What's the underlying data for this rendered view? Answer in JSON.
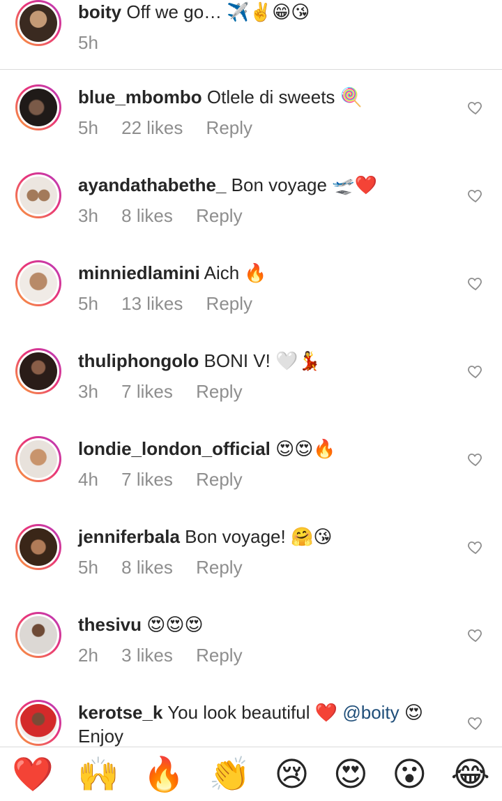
{
  "caption": {
    "username": "boity",
    "text": "Off we go… ✈️✌️😁😘",
    "time": "5h"
  },
  "comments": [
    {
      "username": "blue_mbombo",
      "text": "Otlele di sweets 🍭",
      "time": "5h",
      "likes": "22 likes",
      "reply": "Reply"
    },
    {
      "username": "ayandathabethe_",
      "text": "Bon voyage 🛫❤️",
      "time": "3h",
      "likes": "8 likes",
      "reply": "Reply"
    },
    {
      "username": "minniedlamini",
      "text": "Aich 🔥",
      "time": "5h",
      "likes": "13 likes",
      "reply": "Reply"
    },
    {
      "username": "thuliphongolo",
      "text": "BONI V! 🤍💃",
      "time": "3h",
      "likes": "7 likes",
      "reply": "Reply"
    },
    {
      "username": "londie_london_official",
      "text": "😍😍🔥",
      "time": "4h",
      "likes": "7 likes",
      "reply": "Reply"
    },
    {
      "username": "jenniferbala",
      "text": "Bon voyage! 🤗😘",
      "time": "5h",
      "likes": "8 likes",
      "reply": "Reply"
    },
    {
      "username": "thesivu",
      "text": "😍😍😍",
      "time": "2h",
      "likes": "3 likes",
      "reply": "Reply"
    },
    {
      "username": "kerotse_k",
      "text": "You look beautiful ❤️",
      "mention": "@boity",
      "text_after": "😍",
      "text_line2": "Enjoy"
    }
  ],
  "reaction_bar": [
    "❤️",
    "🙌",
    "🔥",
    "👏",
    "😢",
    "😍",
    "😮",
    "😂"
  ],
  "colors": {
    "avatar_ring_start": "#f9a13a",
    "avatar_ring_end": "#b53cc2",
    "mention": "#1f4e79",
    "meta_text": "#8e8e8e"
  }
}
